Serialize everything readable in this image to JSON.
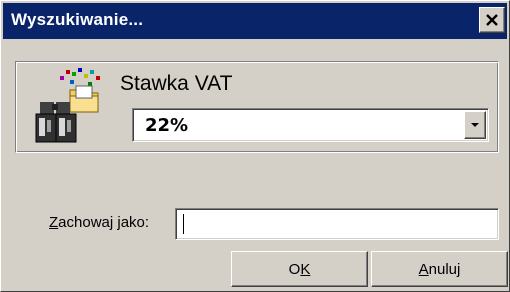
{
  "window": {
    "title": "Wyszukiwanie...",
    "close_icon": "close-icon"
  },
  "search": {
    "icon": "binoculars-search-icon",
    "field_label": "Stawka VAT",
    "selected_value": "22%",
    "dropdown_icon": "chevron-down-icon"
  },
  "save_as": {
    "label_mnemonic": "Z",
    "label_rest": "achowaj jako:",
    "value": ""
  },
  "buttons": {
    "ok_pre": "O",
    "ok_mnemonic": "K",
    "cancel_mnemonic": "A",
    "cancel_rest": "nuluj"
  },
  "colors": {
    "titlebar": "#0a246a",
    "face": "#d4d0c8"
  }
}
